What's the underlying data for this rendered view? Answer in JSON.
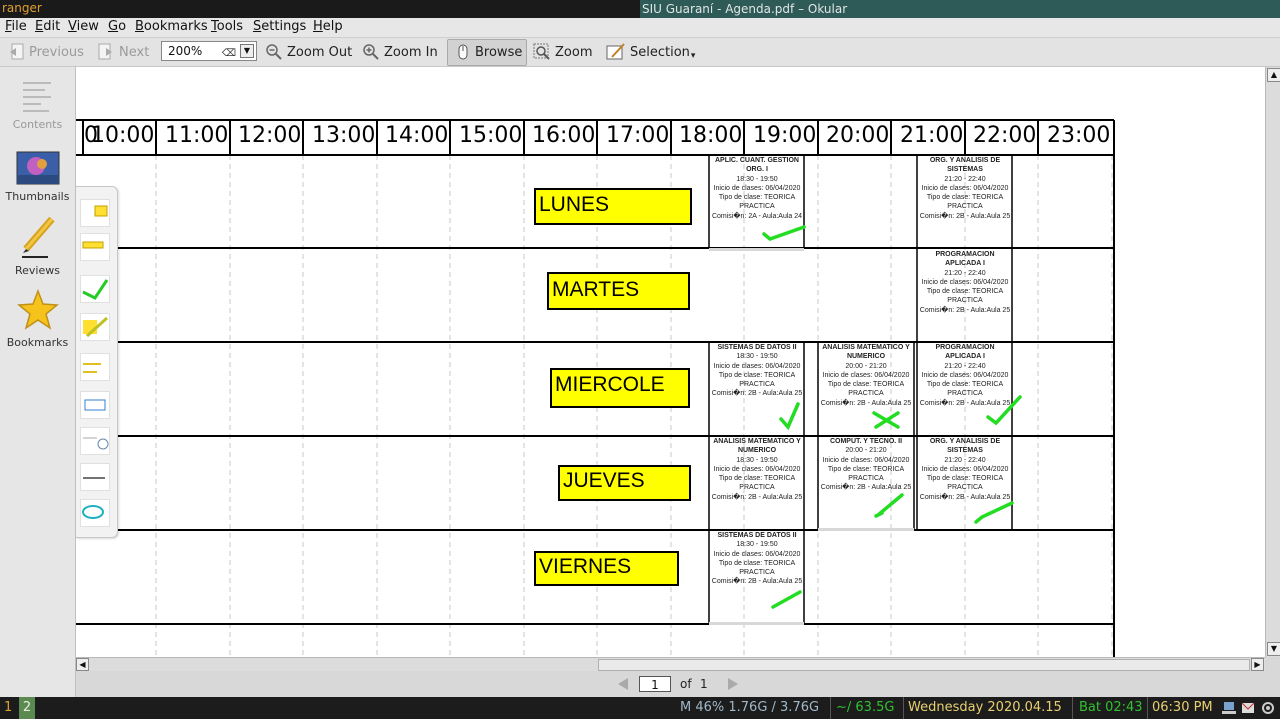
{
  "wm": {
    "left_label": "ranger"
  },
  "window": {
    "title": "SIU Guaraní - Agenda.pdf – Okular"
  },
  "menu": {
    "items": [
      {
        "key": "F",
        "rest": "ile"
      },
      {
        "key": "E",
        "rest": "dit"
      },
      {
        "key": "V",
        "rest": "iew"
      },
      {
        "key": "G",
        "rest": "o"
      },
      {
        "key": "B",
        "rest": "ookmarks"
      },
      {
        "key": "T",
        "rest": "ools"
      },
      {
        "key": "S",
        "rest": "ettings"
      },
      {
        "key": "H",
        "rest": "elp"
      }
    ]
  },
  "toolbar": {
    "previous": "Previous",
    "next": "Next",
    "zoom_value": "200%",
    "zoom_out": "Zoom Out",
    "zoom_in": "Zoom In",
    "browse": "Browse",
    "zoom": "Zoom",
    "selection": "Selection"
  },
  "sidebar": {
    "contents": "Contents",
    "thumbnails": "Thumbnails",
    "reviews": "Reviews",
    "bookmarks": "Bookmarks"
  },
  "pagenav": {
    "current": "1",
    "of": "of",
    "total": "1"
  },
  "status": {
    "ws1": "1",
    "ws2": "2",
    "mem": "M 46%  1.76G / 3.76G",
    "disk": "~/ 63.5G",
    "date": "Wednesday 2020.04.15",
    "battery": "Bat 02:43",
    "time": "06:30 PM"
  },
  "schedule": {
    "hours": [
      "10:00",
      "11:00",
      "12:00",
      "13:00",
      "14:00",
      "15:00",
      "16:00",
      "17:00",
      "18:00",
      "19:00",
      "20:00",
      "21:00",
      "22:00",
      "23:00"
    ],
    "days": [
      "LUNES",
      "MARTES",
      "MIERCOLE",
      "JUEVES",
      "VIERNES"
    ],
    "classes": [
      {
        "title": "APLIC. CUANT. GESTION ORG. I",
        "time": "18:30 - 19:50",
        "start": "Inicio de clases: 06/04/2020",
        "type": "Tipo de clase: TEORICA PRACTICA",
        "comision": "Comisi�n: 2A - Aula:Aula 24",
        "mark": "check"
      },
      {
        "title": "ORG. Y ANALISIS DE SISTEMAS",
        "time": "21:20 - 22:40",
        "start": "Inicio de clases: 06/04/2020",
        "type": "Tipo de clase: TEORICA PRACTICA",
        "comision": "Comisi�n: 2B - Aula:Aula 25",
        "mark": ""
      },
      {
        "title": "PROGRAMACION APLICADA I",
        "time": "21:20 - 22:40",
        "start": "Inicio de clases: 06/04/2020",
        "type": "Tipo de clase: TEORICA PRACTICA",
        "comision": "Comisi�n: 2B - Aula:Aula 25",
        "mark": ""
      },
      {
        "title": "SISTEMAS DE DATOS II",
        "time": "18:30 - 19:50",
        "start": "Inicio de clases: 06/04/2020",
        "type": "Tipo de clase: TEORICA PRACTICA",
        "comision": "Comisi�n: 2B - Aula:Aula 25",
        "mark": "check"
      },
      {
        "title": "ANALISIS MATEMATICO Y NUMERICO",
        "time": "20:00 - 21:20",
        "start": "Inicio de clases: 06/04/2020",
        "type": "Tipo de clase: TEORICA PRACTICA",
        "comision": "Comisi�n: 2B - Aula:Aula 25",
        "mark": "cross"
      },
      {
        "title": "PROGRAMACION APLICADA I",
        "time": "21:20 - 22:40",
        "start": "Inicio de clases: 06/04/2020",
        "type": "Tipo de clase: TEORICA PRACTICA",
        "comision": "Comisi�n: 2B - Aula:Aula 25",
        "mark": "check"
      },
      {
        "title": "ANALISIS MATEMATICO Y NUMERICO",
        "time": "18:30 - 19:50",
        "start": "Inicio de clases: 06/04/2020",
        "type": "Tipo de clase: TEORICA PRACTICA",
        "comision": "Comisi�n: 2B - Aula:Aula 25",
        "mark": ""
      },
      {
        "title": "COMPUT. Y TECNO. II",
        "time": "20:00 - 21:20",
        "start": "Inicio de clases: 06/04/2020",
        "type": "Tipo de clase: TEORICA PRACTICA",
        "comision": "Comisi�n: 2B - Aula:Aula 25",
        "mark": "check"
      },
      {
        "title": "ORG. Y ANALISIS DE SISTEMAS",
        "time": "21:20 - 22:40",
        "start": "Inicio de clases: 06/04/2020",
        "type": "Tipo de clase: TEORICA PRACTICA",
        "comision": "Comisi�n: 2B - Aula:Aula 25",
        "mark": "check"
      },
      {
        "title": "SISTEMAS DE DATOS II",
        "time": "18:30 - 19:50",
        "start": "Inicio de clases: 06/04/2020",
        "type": "Tipo de clase: TEORICA PRACTICA",
        "comision": "Comisi�n: 2B - Aula:Aula 25",
        "mark": "check"
      }
    ]
  },
  "colors": {
    "day_fill": "#ffff00",
    "annotation_mark": "#22dd22",
    "title_bar": "#2e5a57"
  }
}
